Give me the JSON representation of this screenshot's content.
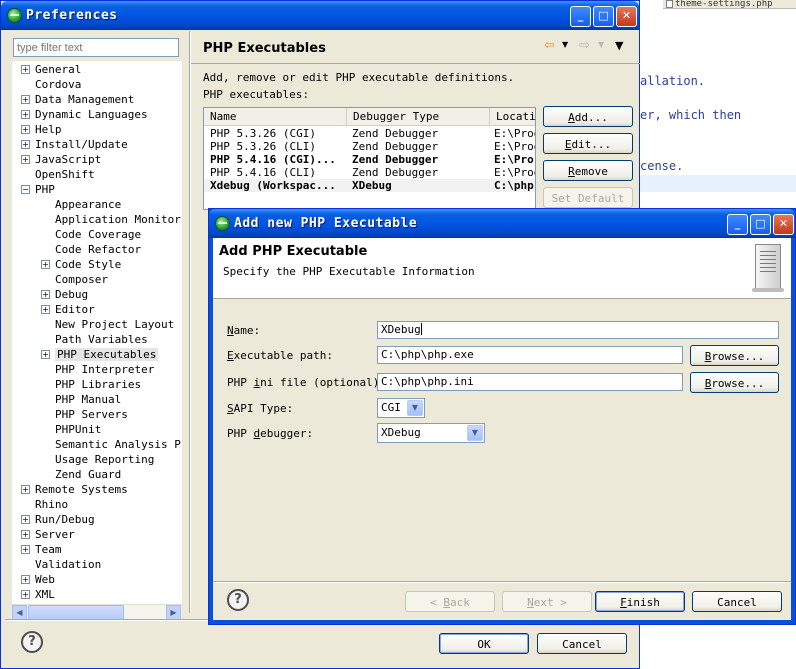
{
  "background_editor": {
    "tab_label": "theme-settings.php",
    "lines": [
      "allation.",
      "er, which then",
      "cense."
    ]
  },
  "preferences": {
    "title": "Preferences",
    "filter_placeholder": "type filter text",
    "tree": [
      {
        "label": "General",
        "level": 0,
        "expander": "+"
      },
      {
        "label": "Cordova",
        "level": 0,
        "expander": ""
      },
      {
        "label": "Data Management",
        "level": 0,
        "expander": "+"
      },
      {
        "label": "Dynamic Languages",
        "level": 0,
        "expander": "+"
      },
      {
        "label": "Help",
        "level": 0,
        "expander": "+"
      },
      {
        "label": "Install/Update",
        "level": 0,
        "expander": "+"
      },
      {
        "label": "JavaScript",
        "level": 0,
        "expander": "+"
      },
      {
        "label": "OpenShift",
        "level": 0,
        "expander": ""
      },
      {
        "label": "PHP",
        "level": 0,
        "expander": "−"
      },
      {
        "label": "Appearance",
        "level": 1,
        "expander": ""
      },
      {
        "label": "Application Monitorin",
        "level": 1,
        "expander": ""
      },
      {
        "label": "Code Coverage",
        "level": 1,
        "expander": ""
      },
      {
        "label": "Code Refactor",
        "level": 1,
        "expander": ""
      },
      {
        "label": "Code Style",
        "level": 1,
        "expander": "+"
      },
      {
        "label": "Composer",
        "level": 1,
        "expander": ""
      },
      {
        "label": "Debug",
        "level": 1,
        "expander": "+"
      },
      {
        "label": "Editor",
        "level": 1,
        "expander": "+"
      },
      {
        "label": "New Project Layout",
        "level": 1,
        "expander": ""
      },
      {
        "label": "Path Variables",
        "level": 1,
        "expander": ""
      },
      {
        "label": "PHP Executables",
        "level": 1,
        "expander": "+",
        "selected": true
      },
      {
        "label": "PHP Interpreter",
        "level": 1,
        "expander": ""
      },
      {
        "label": "PHP Libraries",
        "level": 1,
        "expander": ""
      },
      {
        "label": "PHP Manual",
        "level": 1,
        "expander": ""
      },
      {
        "label": "PHP Servers",
        "level": 1,
        "expander": ""
      },
      {
        "label": "PHPUnit",
        "level": 1,
        "expander": ""
      },
      {
        "label": "Semantic Analysis Pro",
        "level": 1,
        "expander": ""
      },
      {
        "label": "Usage Reporting",
        "level": 1,
        "expander": ""
      },
      {
        "label": "Zend Guard",
        "level": 1,
        "expander": ""
      },
      {
        "label": "Remote Systems",
        "level": 0,
        "expander": "+"
      },
      {
        "label": "Rhino",
        "level": 0,
        "expander": ""
      },
      {
        "label": "Run/Debug",
        "level": 0,
        "expander": "+"
      },
      {
        "label": "Server",
        "level": 0,
        "expander": "+"
      },
      {
        "label": "Team",
        "level": 0,
        "expander": "+"
      },
      {
        "label": "Validation",
        "level": 0,
        "expander": ""
      },
      {
        "label": "Web",
        "level": 0,
        "expander": "+"
      },
      {
        "label": "XML",
        "level": 0,
        "expander": "+"
      }
    ],
    "page_title": "PHP Executables",
    "description": "Add, remove or edit PHP executable definitions.",
    "list_label": "PHP executables:",
    "table": {
      "columns": [
        "Name",
        "Debugger Type",
        "Locati"
      ],
      "rows": [
        {
          "name": "PHP 5.3.26 (CGI)",
          "debugger": "Zend Debugger",
          "location": "E:\\Prog",
          "bold": false
        },
        {
          "name": "PHP 5.3.26 (CLI)",
          "debugger": "Zend Debugger",
          "location": "E:\\Prog",
          "bold": false
        },
        {
          "name": "PHP 5.4.16 (CGI)...",
          "debugger": "Zend Debugger",
          "location": "E:\\Pro",
          "bold": true
        },
        {
          "name": "PHP 5.4.16 (CLI)",
          "debugger": "Zend Debugger",
          "location": "E:\\Prog",
          "bold": false
        },
        {
          "name": "Xdebug (Workspac...",
          "debugger": "XDebug",
          "location": "C:\\php",
          "bold": true
        }
      ]
    },
    "buttons": {
      "add": "Add...",
      "edit": "Edit...",
      "remove": "Remove",
      "set_default": "Set Default",
      "ok": "OK",
      "cancel": "Cancel"
    }
  },
  "dialog": {
    "title": "Add new PHP Executable",
    "banner_title": "Add PHP Executable",
    "banner_message": "Specify the PHP Executable Information",
    "fields": {
      "name_label": "Name:",
      "name_value": "XDebug",
      "exe_label": "Executable path:",
      "exe_value": "C:\\php\\php.exe",
      "ini_label": "PHP ini file (optional):",
      "ini_value": "C:\\php\\php.ini",
      "sapi_label": "SAPI Type:",
      "sapi_value": "CGI",
      "debugger_label": "PHP debugger:",
      "debugger_value": "XDebug"
    },
    "buttons": {
      "browse_exe": "Browse...",
      "browse_ini": "Browse...",
      "back": "< Back",
      "next": "Next >",
      "finish": "Finish",
      "cancel": "Cancel"
    }
  }
}
